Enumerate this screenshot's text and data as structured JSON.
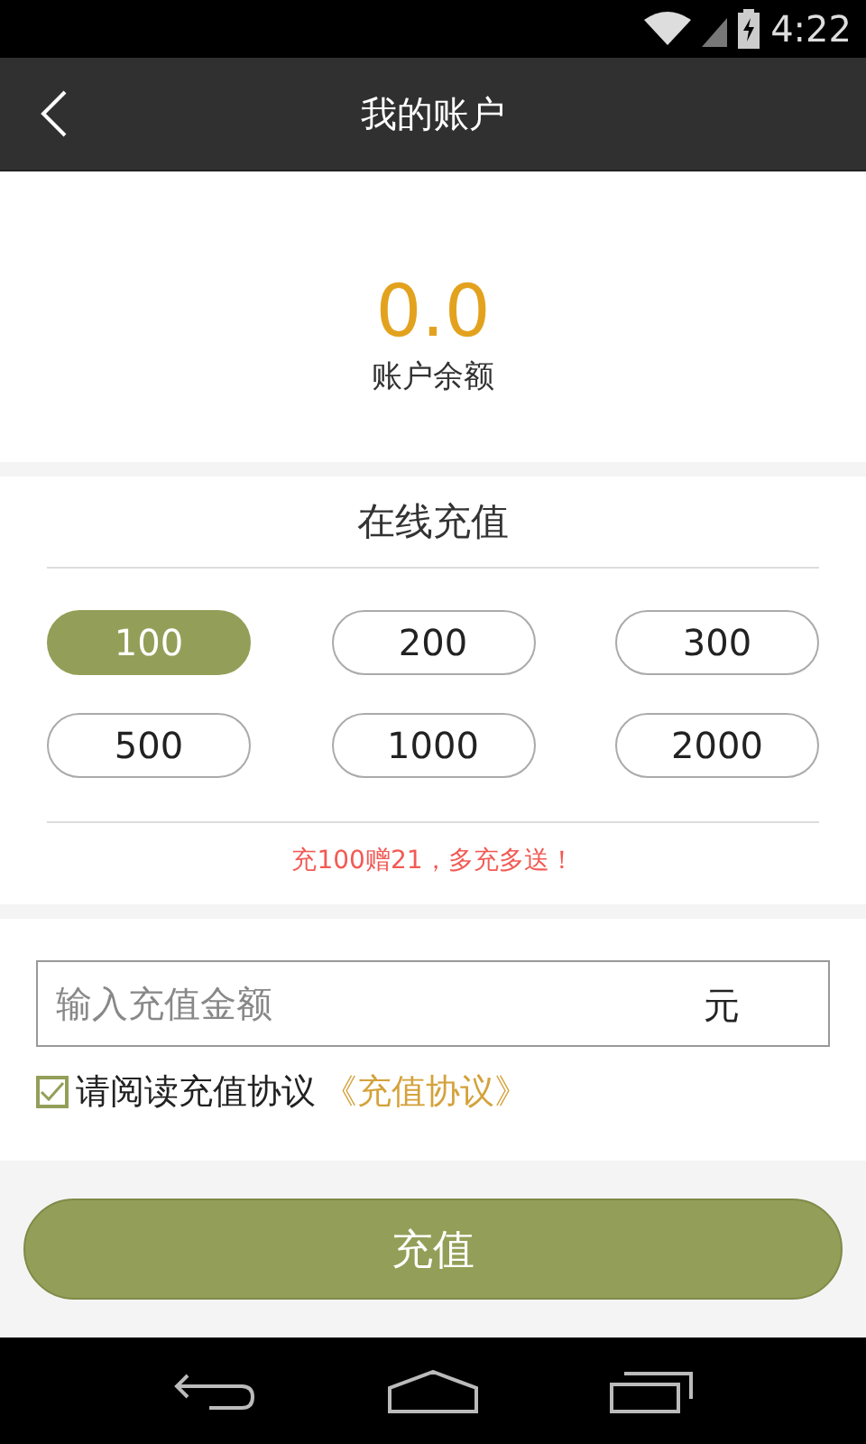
{
  "status_bar": {
    "time": "4:22"
  },
  "header": {
    "title": "我的账户"
  },
  "balance": {
    "amount": "0.0",
    "label": "账户余额"
  },
  "recharge": {
    "title": "在线充值",
    "options": [
      {
        "label": "100",
        "selected": true
      },
      {
        "label": "200",
        "selected": false
      },
      {
        "label": "300",
        "selected": false
      },
      {
        "label": "500",
        "selected": false
      },
      {
        "label": "1000",
        "selected": false
      },
      {
        "label": "2000",
        "selected": false
      }
    ],
    "promo": "充100赠21，多充多送！"
  },
  "amount_field": {
    "placeholder": "输入充值金额",
    "unit": "元"
  },
  "agreement": {
    "checked": true,
    "text": "请阅读充值协议",
    "link": "《充值协议》"
  },
  "submit_button": "充值"
}
